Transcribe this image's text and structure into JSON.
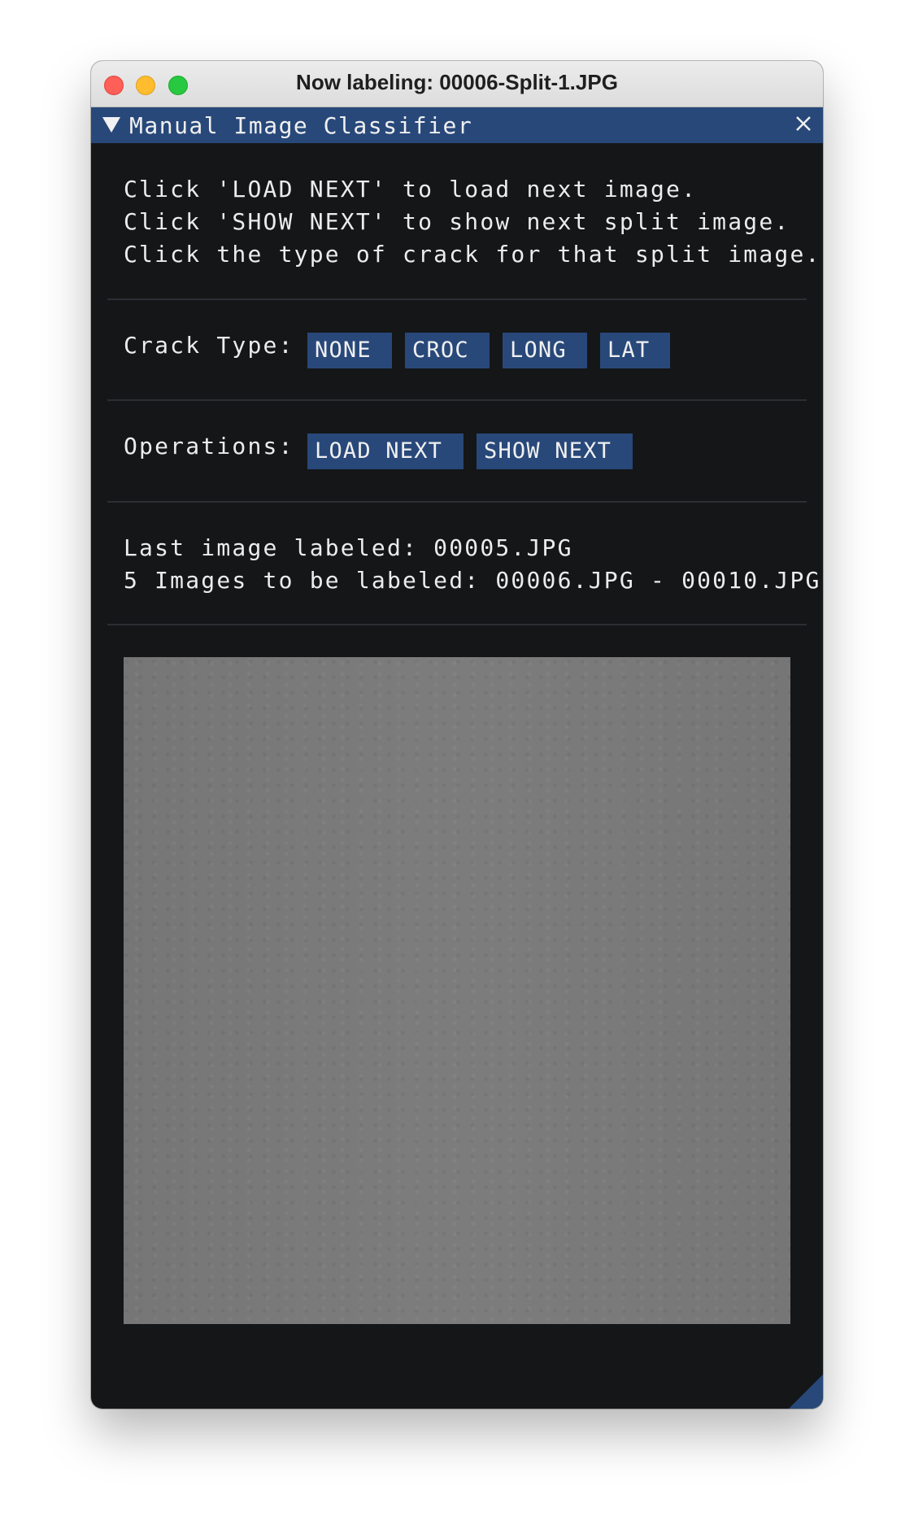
{
  "window": {
    "title": "Now labeling: 00006-Split-1.JPG"
  },
  "panel": {
    "title": "Manual Image Classifier",
    "collapse_icon": "triangle-down-icon",
    "close_icon": "close-icon"
  },
  "instructions": [
    "Click 'LOAD NEXT' to load next image.",
    "Click 'SHOW NEXT' to show next split image.",
    "Click the type of crack for that split image."
  ],
  "crack_type": {
    "label": "Crack Type:",
    "buttons": [
      "NONE",
      "CROC",
      "LONG",
      "LAT"
    ]
  },
  "operations": {
    "label": "Operations:",
    "buttons": [
      "LOAD NEXT",
      "SHOW NEXT"
    ]
  },
  "status": {
    "last_labeled": "Last image labeled: 00005.JPG",
    "to_be_labeled": "5 Images to be labeled: 00006.JPG - 00010.JPG"
  },
  "colors": {
    "accent": "#28487a",
    "panel_bg": "#151618",
    "text": "#ececec"
  }
}
